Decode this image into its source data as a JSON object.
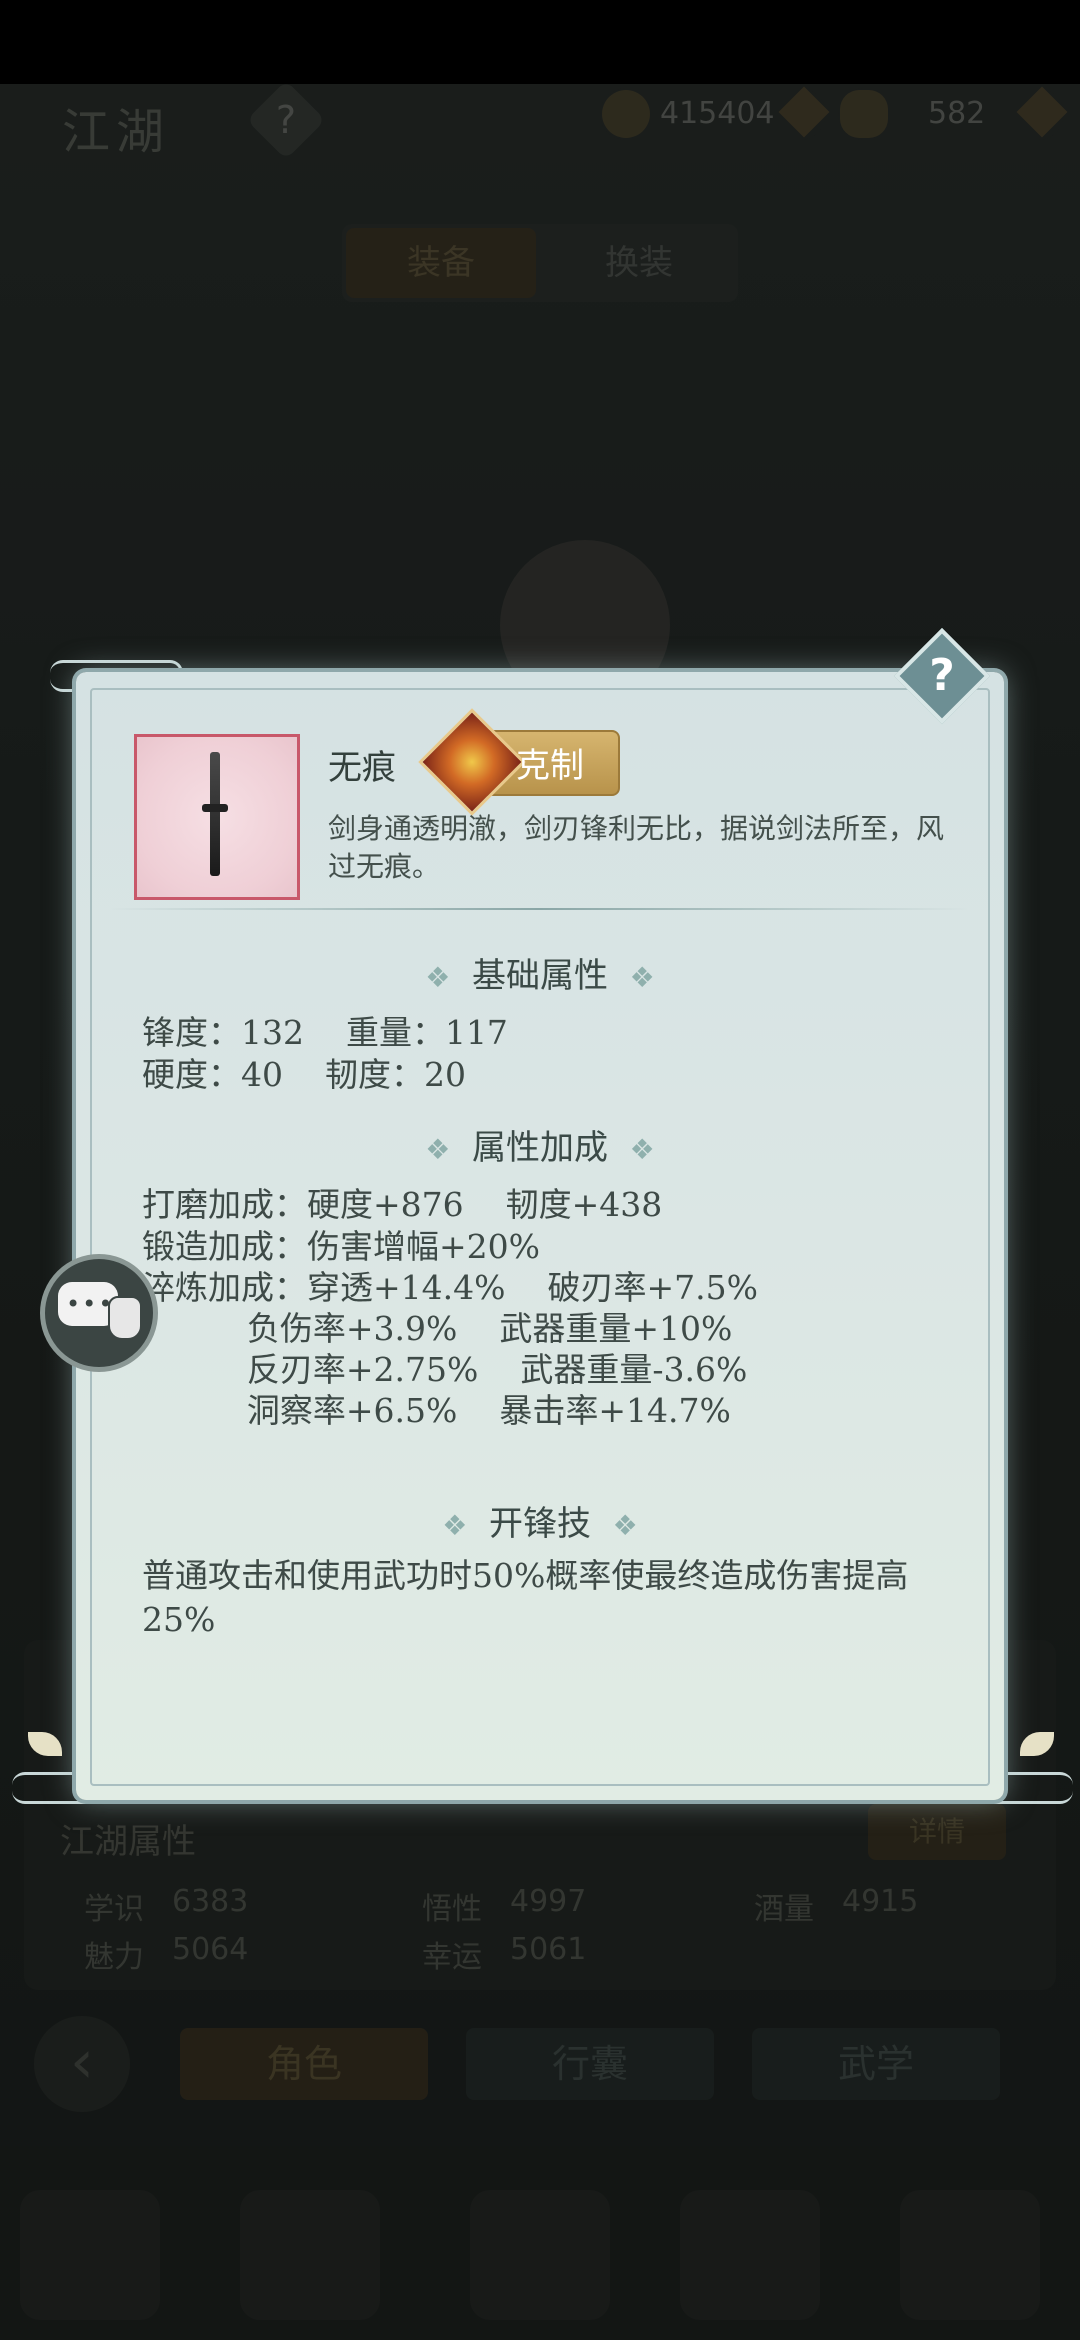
{
  "background": {
    "title": "江湖",
    "currency_coins": "415404",
    "currency_ingots": "582",
    "tabs": [
      "装备",
      "换装"
    ],
    "attributes_title": "江湖属性",
    "attributes_button": "详情",
    "stats": [
      {
        "label": "学识",
        "value": "6383"
      },
      {
        "label": "悟性",
        "value": "4997"
      },
      {
        "label": "酒量",
        "value": "4915"
      },
      {
        "label": "魅力",
        "value": "5064"
      },
      {
        "label": "幸运",
        "value": "5061"
      }
    ],
    "bottom_tabs": [
      "角色",
      "行囊",
      "武学"
    ]
  },
  "dialog": {
    "help_label": "?",
    "item": {
      "name": "无痕",
      "badge": "克制",
      "description": "剑身通透明澈，剑刃锋利无比，据说剑法所至，风过无痕。"
    },
    "base_section": {
      "title": "基础属性",
      "lines": [
        "锋度：132    重量：117",
        "硬度：40    韧度：20"
      ]
    },
    "bonus_section": {
      "title": "属性加成",
      "lines": [
        "打磨加成：硬度+876    韧度+438",
        "锻造加成：伤害增幅+20%",
        "淬炼加成：穿透+14.4%    破刃率+7.5%",
        "          负伤率+3.9%    武器重量+10%",
        "          反刃率+2.75%    武器重量-3.6%",
        "          洞察率+6.5%    暴击率+14.7%"
      ]
    },
    "skill_section": {
      "title": "开锋技",
      "text": "普通攻击和使用武功时50%概率使最终造成伤害提高25%"
    }
  },
  "decor": {
    "section_ornament": "❖"
  }
}
